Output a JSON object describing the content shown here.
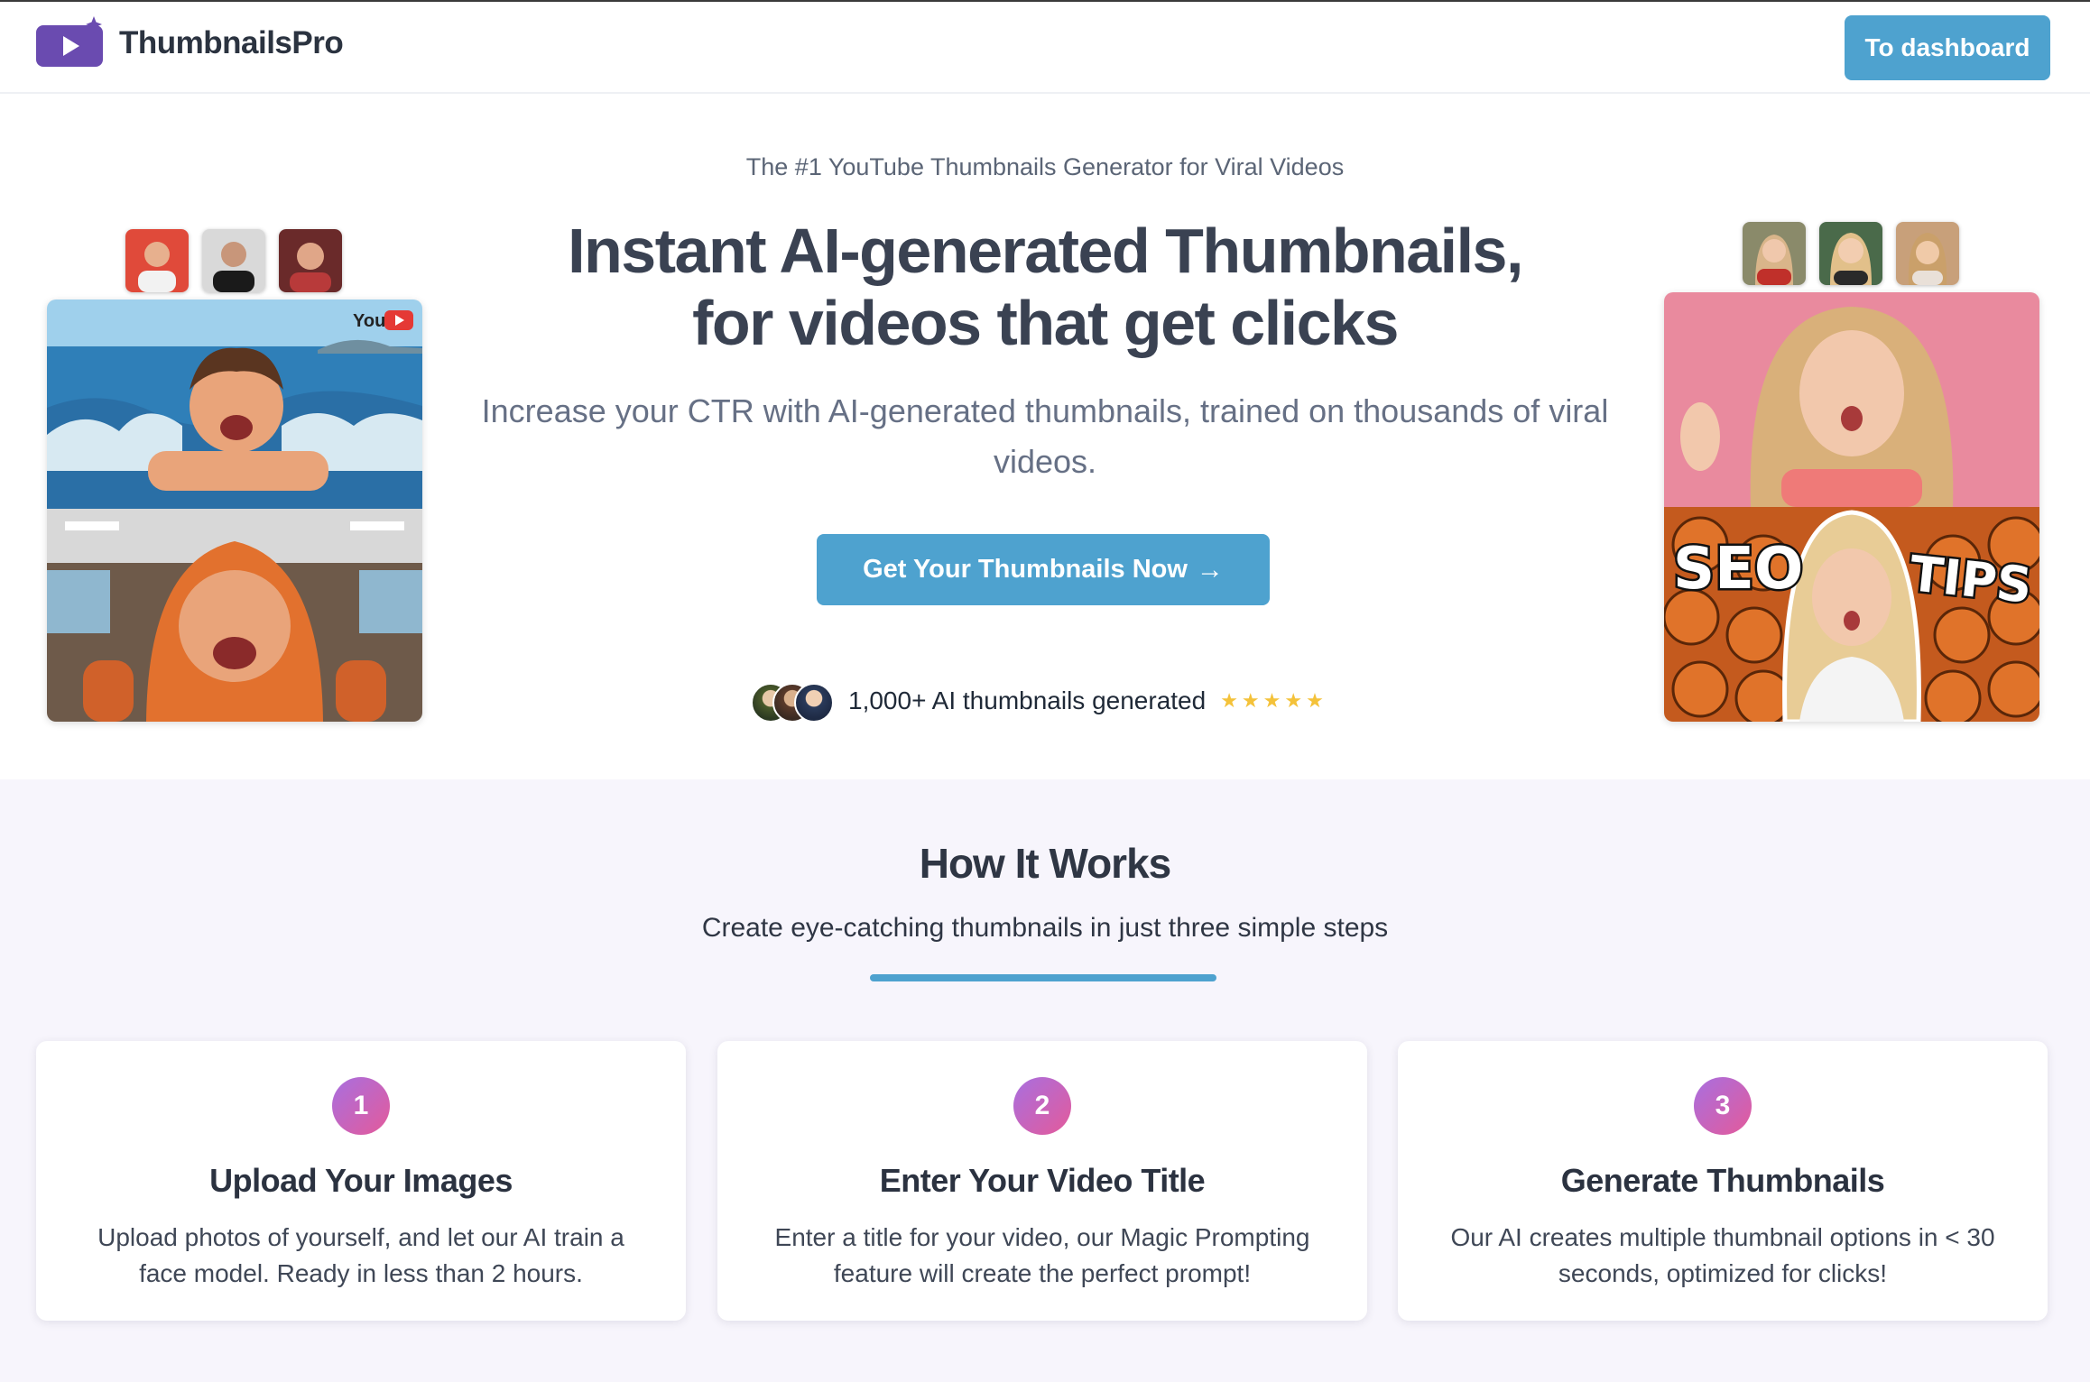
{
  "nav": {
    "brand": "ThumbnailsPro",
    "dashboard_button": "To dashboard"
  },
  "hero": {
    "tagline": "The #1 YouTube Thumbnails Generator for Viral Videos",
    "headline_line1": "Instant AI-generated Thumbnails,",
    "headline_line2": "for videos that get clicks",
    "subhead": "Increase your CTR with AI-generated thumbnails, trained on thousands of viral videos.",
    "cta_label": "Get Your Thumbnails Now",
    "cta_arrow": "→",
    "proof_text": "1,000+ AI thumbnails generated",
    "rating_stars": 5
  },
  "collage_right": {
    "text_left": "SEO",
    "text_right": "TIPS"
  },
  "collage_left": {
    "badge": "You"
  },
  "how_it_works": {
    "title": "How It Works",
    "subtitle": "Create eye-catching thumbnails in just three simple steps",
    "steps": [
      {
        "number": "1",
        "title": "Upload Your Images",
        "text": "Upload photos of yourself, and let our AI train a face model. Ready in less than 2 hours."
      },
      {
        "number": "2",
        "title": "Enter Your Video Title",
        "text": "Enter a title for your video, our Magic Prompting feature will create the perfect prompt!"
      },
      {
        "number": "3",
        "title": "Generate Thumbnails",
        "text": "Our AI creates multiple thumbnail options in < 30 seconds, optimized for clicks!"
      }
    ]
  },
  "colors": {
    "accent": "#4ea2cf",
    "brand_purple": "#6a4bb0",
    "section_bg": "#f7f5fc",
    "star": "#f4c23a"
  }
}
